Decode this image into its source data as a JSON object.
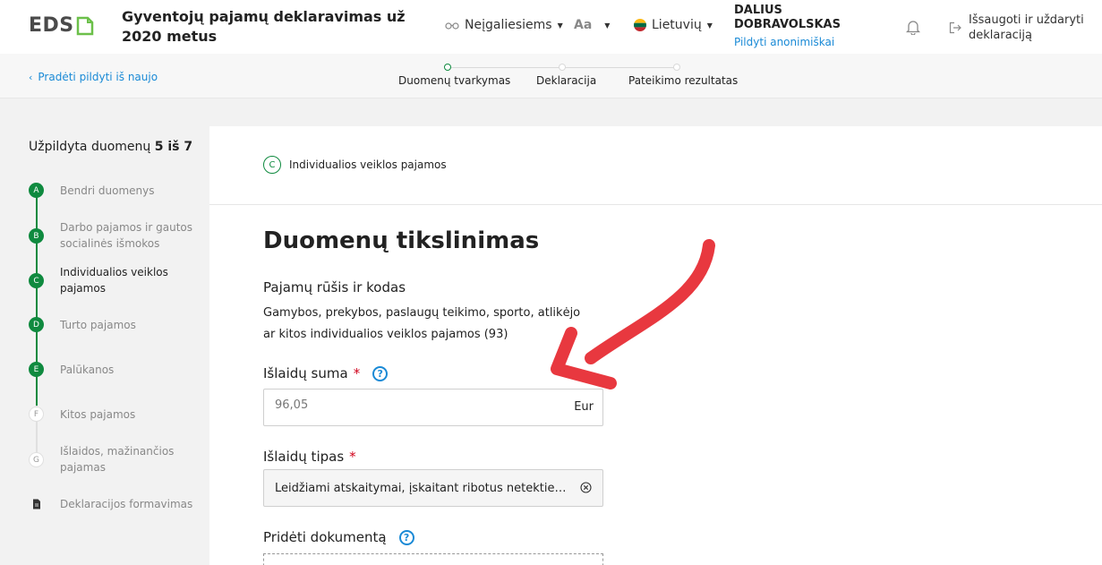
{
  "header": {
    "logo": "EDS",
    "title": "Gyventojų pajamų deklaravimas už 2020 metus",
    "disabled_label": "Neįgaliesiems",
    "font_size_label": "Aa",
    "language_label": "Lietuvių",
    "user_name": "DALIUS DOBRAVOLSKAS",
    "user_action": "Pildyti anonimiškai",
    "save_exit": "Išsaugoti ir uždaryti deklaraciją"
  },
  "subheader": {
    "restart": "Pradėti pildyti iš naujo",
    "steps": [
      "Duomenų tvarkymas",
      "Deklaracija",
      "Pateikimo rezultatas"
    ]
  },
  "sidebar": {
    "progress_prefix": "Užpildyta duomenų",
    "progress_value": "5 iš 7",
    "items": [
      {
        "badge": "A",
        "label": "Bendri duomenys"
      },
      {
        "badge": "B",
        "label": "Darbo pajamos ir gautos socialinės išmokos"
      },
      {
        "badge": "C",
        "label": "Individualios veiklos pajamos"
      },
      {
        "badge": "D",
        "label": "Turto pajamos"
      },
      {
        "badge": "E",
        "label": "Palūkanos"
      },
      {
        "badge": "F",
        "label": "Kitos pajamos"
      },
      {
        "badge": "G",
        "label": "Išlaidos, mažinančios pajamas"
      },
      {
        "badge": "",
        "label": "Deklaracijos formavimas"
      }
    ]
  },
  "main": {
    "section_badge": "C",
    "section_label": "Individualios veiklos pajamos",
    "title": "Duomenų tikslinimas",
    "income_type_label": "Pajamų rūšis ir kodas",
    "income_type_value": "Gamybos, prekybos, paslaugų teikimo, sporto, atlikėjo ar kitos individualios veiklos pajamos (93)",
    "expense_sum_label": "Išlaidų suma",
    "required_mark": "*",
    "expense_sum_value": "96,05",
    "currency": "Eur",
    "expense_type_label": "Išlaidų tipas",
    "expense_type_value": "Leidžiami atskaitymai, įskaitant ribotus netekties nu...",
    "document_label": "Pridėti dokumentą",
    "help_glyph": "?"
  },
  "colors": {
    "accent_green": "#0f8a3f",
    "link_blue": "#1a8ad6",
    "required_red": "#d0021b",
    "annotation_red": "#e8383f"
  }
}
